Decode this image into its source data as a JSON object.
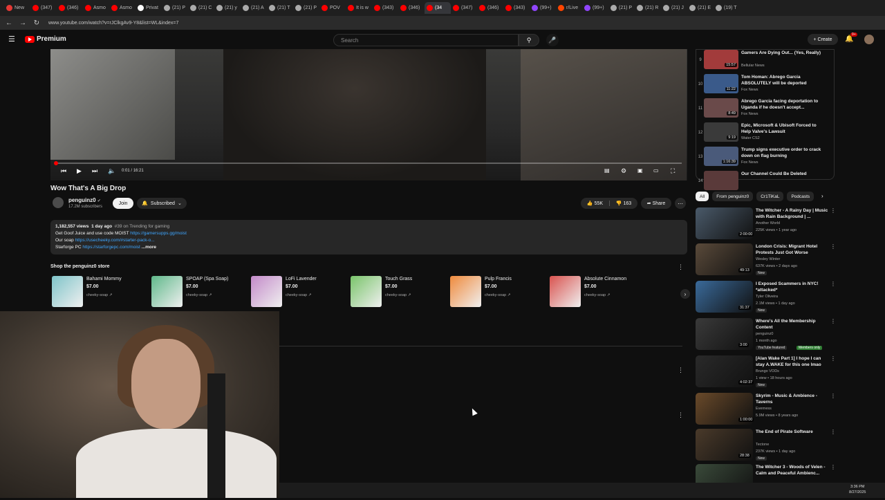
{
  "browser": {
    "tabs": [
      {
        "label": "New",
        "color": "#e53935"
      },
      {
        "label": "(347)",
        "color": "#ff0000"
      },
      {
        "label": "(346)",
        "color": "#ff0000"
      },
      {
        "label": "Asmo",
        "color": "#ff0000"
      },
      {
        "label": "Asmo",
        "color": "#ff0000"
      },
      {
        "label": "Privat",
        "color": "#ffffff"
      },
      {
        "label": "(21) P",
        "color": "#aaaaaa"
      },
      {
        "label": "(21) C",
        "color": "#aaaaaa"
      },
      {
        "label": "(21) y",
        "color": "#aaaaaa"
      },
      {
        "label": "(21) A",
        "color": "#aaaaaa"
      },
      {
        "label": "(21) T",
        "color": "#aaaaaa"
      },
      {
        "label": "(21) P",
        "color": "#aaaaaa"
      },
      {
        "label": "POV",
        "color": "#ff0000"
      },
      {
        "label": "It is w",
        "color": "#ff0000"
      },
      {
        "label": "(343)",
        "color": "#ff0000"
      },
      {
        "label": "(346)",
        "color": "#ff0000"
      },
      {
        "label": "(34",
        "color": "#ff0000"
      },
      {
        "label": "(347)",
        "color": "#ff0000"
      },
      {
        "label": "(346)",
        "color": "#ff0000"
      },
      {
        "label": "(343)",
        "color": "#ff0000"
      },
      {
        "label": "(99+)",
        "color": "#9146ff"
      },
      {
        "label": "r/Live",
        "color": "#ff4500"
      },
      {
        "label": "(99+)",
        "color": "#9146ff"
      },
      {
        "label": "(21) P",
        "color": "#aaaaaa"
      },
      {
        "label": "(21) R",
        "color": "#aaaaaa"
      },
      {
        "label": "(21) J",
        "color": "#aaaaaa"
      },
      {
        "label": "(21) E",
        "color": "#aaaaaa"
      },
      {
        "label": "(19) T",
        "color": "#aaaaaa"
      }
    ],
    "url": "www.youtube.com/watch?v=rJClkgAv9-Y8&list=WL&index=7"
  },
  "header": {
    "logo_text": "Premium",
    "search_placeholder": "Search",
    "create_label": "Create",
    "notif_count": "9+"
  },
  "player": {
    "time_current": "0:01",
    "time_total": "16:21",
    "progress": 0.001
  },
  "video": {
    "title": "Wow That's A Big Drop",
    "channel": "penguinz0",
    "subscribers": "17.2M subscribers",
    "join_label": "Join",
    "subscribed_label": "Subscribed",
    "likes": "55K",
    "dislikes": "163",
    "share_label": "Share"
  },
  "description": {
    "views": "1,182,557 views",
    "age": "1 day ago",
    "trending": "#39 on Trending for gaming",
    "line1_text": "Get Goof Juice and use code MOIST",
    "line1_link": "https://gamersupps.gg/moist",
    "line2_text": "Our soap",
    "line2_link": "https://usecheeky.com/#starter-pack-o...",
    "line3_text": "Starforge PC",
    "line3_link": "https://starforgepc.com/moist",
    "more": "...more"
  },
  "store": {
    "title": "Shop the penguinz0 store",
    "products": [
      {
        "name": "Bahami Mommy",
        "price": "$7.00",
        "seller": "cheeky-soap",
        "color": "#7fc4c9"
      },
      {
        "name": "SPOAP (Spa Soap)",
        "price": "$7.00",
        "seller": "cheeky-soap",
        "color": "#5fb88a"
      },
      {
        "name": "LoFi Lavender",
        "price": "$7.00",
        "seller": "cheeky-soap",
        "color": "#c38ac9"
      },
      {
        "name": "Touch Grass",
        "price": "$7.00",
        "seller": "cheeky-soap",
        "color": "#79c46a"
      },
      {
        "name": "Pulp Francis",
        "price": "$7.00",
        "seller": "cheeky-soap",
        "color": "#ef8a3c"
      },
      {
        "name": "Absolute Cinnamon",
        "price": "$7.00",
        "seller": "cheeky-soap",
        "color": "#d9534f"
      }
    ]
  },
  "playlist": [
    {
      "idx": "9",
      "title": "Gamers Are Dying Out... (Yes, Really)",
      "channel": "Bellular News",
      "dur": "15:57",
      "color": "#a23b3b"
    },
    {
      "idx": "10",
      "title": "Tom Homan: Abrego Garcia ABSOLUTELY will be deported",
      "channel": "Fox News",
      "dur": "11:22",
      "color": "#3a5a8a"
    },
    {
      "idx": "11",
      "title": "Abrego Garcia facing deportation to Uganda if he doesn't accept...",
      "channel": "Fox News",
      "dur": "8:49",
      "color": "#6a4a4a"
    },
    {
      "idx": "12",
      "title": "Epic, Microsoft & Ubisoft Forced to Help Valve's Lawsuit",
      "channel": "Water CS2",
      "dur": "9:19",
      "color": "#3a3a3a"
    },
    {
      "idx": "13",
      "title": "Trump signs executive order to crack down on flag burning",
      "channel": "Fox News",
      "dur": "1:16:39",
      "color": "#4a5a7a"
    },
    {
      "idx": "14",
      "title": "Our Channel Could Be Deleted",
      "channel": "",
      "dur": "",
      "color": "#5a3a3a"
    }
  ],
  "chips": [
    "All",
    "From penguinz0",
    "Cr1TiKaL",
    "Podcasts"
  ],
  "recommendations": [
    {
      "title": "The Witcher - A Rainy Day | Music with Rain Background | ...",
      "channel": "Another World",
      "meta": "225K views • 1 year ago",
      "dur": "2:00:00",
      "badge": "",
      "badge2": "",
      "color": "#4a5a6a"
    },
    {
      "title": "London Crisis: Migrant Hotel Protests Just Got Worse",
      "channel": "Wesley Winter",
      "meta": "637K views • 2 days ago",
      "dur": "49:13",
      "badge": "New",
      "badge2": "",
      "color": "#5a4a3a"
    },
    {
      "title": "I Exposed Scammers in NYC! *attacked*",
      "channel": "Tyler Oliveira",
      "meta": "2.1M views • 1 day ago",
      "dur": "31:37",
      "badge": "New",
      "badge2": "",
      "color": "#3a6a9a"
    },
    {
      "title": "Where's All the Membership Content",
      "channel": "penguinz0",
      "meta": "1 month ago",
      "dur": "3:00",
      "badge": "YouTube featured",
      "badge2": "Members only",
      "color": "#3a3a3a"
    },
    {
      "title": "[Alan Wake Part 1] I hope I can stay A.WAKE for this one lmao",
      "channel": "Brungo VODs",
      "meta": "1 view • 18 hours ago",
      "dur": "4:02:37",
      "badge": "New",
      "badge2": "",
      "color": "#2a2a2a"
    },
    {
      "title": "Skyrim - Music & Ambience - Taverns",
      "channel": "Everness",
      "meta": "5.9M views • 8 years ago",
      "dur": "1:00:00",
      "badge": "",
      "badge2": "",
      "color": "#6a4a2a"
    },
    {
      "title": "The End of Pirate Software",
      "channel": "Tectone",
      "meta": "237K views • 1 day ago",
      "dur": "28:38",
      "badge": "New",
      "badge2": "",
      "color": "#4a3a2a"
    },
    {
      "title": "The Witcher 3 - Woods of Velen - Calm and Peaceful Ambienc...",
      "channel": "",
      "meta": "",
      "dur": "",
      "badge": "",
      "badge2": "",
      "color": "#3a4a3a"
    }
  ],
  "clock": {
    "time": "3:36 PM",
    "date": "8/27/2025"
  }
}
